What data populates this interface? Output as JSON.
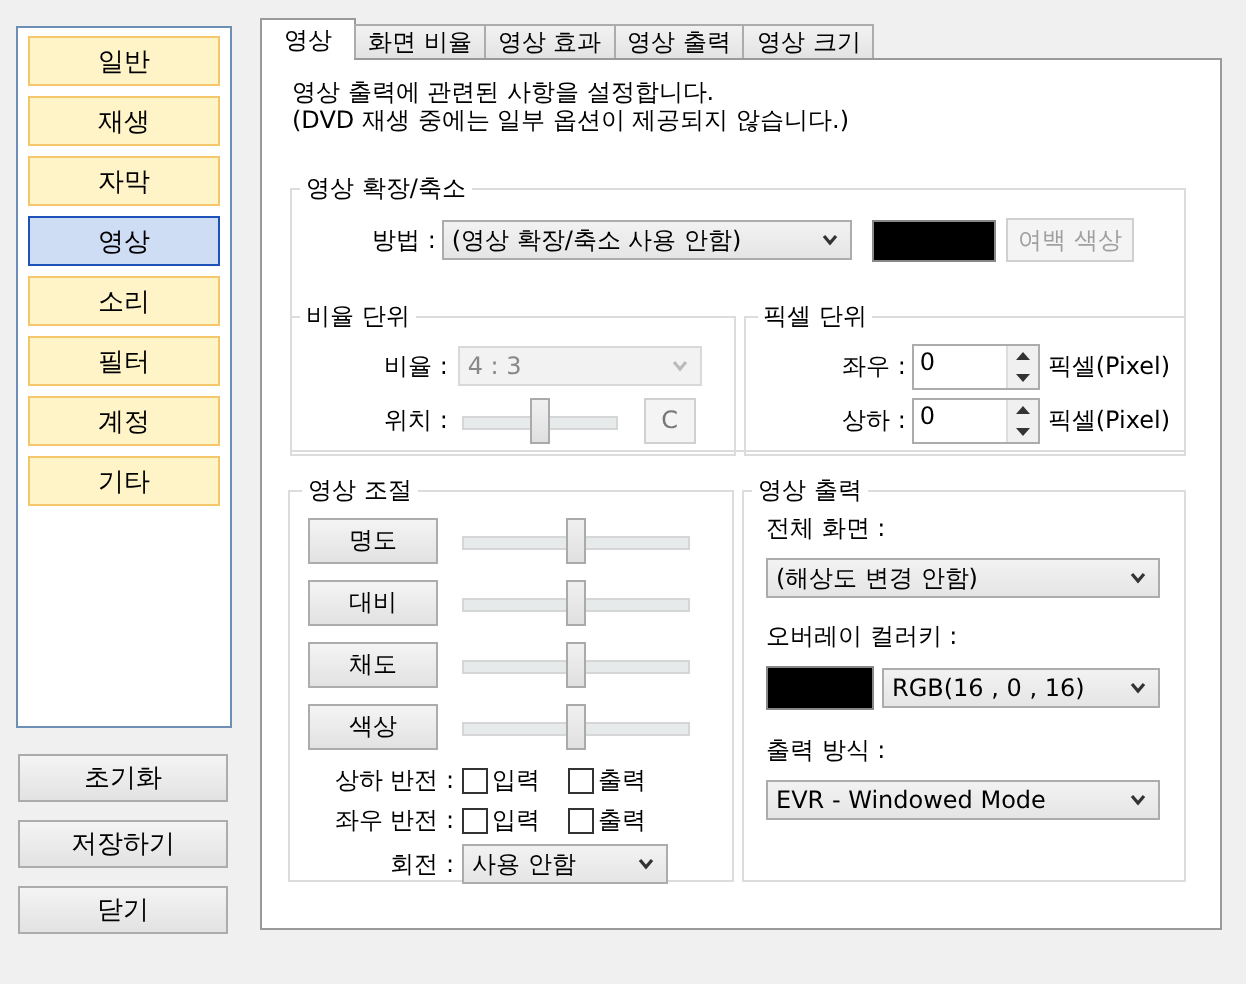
{
  "sidebar": {
    "items": [
      {
        "label": "일반",
        "selected": false
      },
      {
        "label": "재생",
        "selected": false
      },
      {
        "label": "자막",
        "selected": false
      },
      {
        "label": "영상",
        "selected": true
      },
      {
        "label": "소리",
        "selected": false
      },
      {
        "label": "필터",
        "selected": false
      },
      {
        "label": "계정",
        "selected": false
      },
      {
        "label": "기타",
        "selected": false
      }
    ],
    "buttons": [
      "초기화",
      "저장하기",
      "닫기"
    ]
  },
  "tabs": [
    {
      "label": "영상",
      "selected": true
    },
    {
      "label": "화면 비율",
      "selected": false
    },
    {
      "label": "영상 효과",
      "selected": false
    },
    {
      "label": "영상 출력",
      "selected": false
    },
    {
      "label": "영상 크기",
      "selected": false
    }
  ],
  "description": "영상 출력에 관련된 사항을 설정합니다.\n(DVD 재생 중에는 일부 옵션이 제공되지 않습니다.)",
  "scaling": {
    "title": "영상 확장/축소",
    "method_label": "방법 :",
    "method_value": "(영상 확장/축소 사용 안함)",
    "margin_swatch": {
      "color": "#000000"
    },
    "margin_button": {
      "label": "여백 색상",
      "disabled": true
    },
    "ratio_unit": {
      "title": "비율 단위",
      "ratio_label": "비율 :",
      "ratio": {
        "value": "4 : 3",
        "disabled": true
      },
      "position_label": "위치 :",
      "position": {
        "level": 0.5
      },
      "reset_button": {
        "label": "C",
        "disabled": true
      }
    },
    "pixel_unit": {
      "title": "픽셀 단위",
      "fields": [
        {
          "label": "좌우 :",
          "value": "0",
          "unit": "픽셀(Pixel)"
        },
        {
          "label": "상하 :",
          "value": "0",
          "unit": "픽셀(Pixel)"
        }
      ]
    }
  },
  "adjust": {
    "title": "영상 조절",
    "sliders": [
      {
        "label": "명도",
        "level": 0.5
      },
      {
        "label": "대비",
        "level": 0.5
      },
      {
        "label": "채도",
        "level": 0.5
      },
      {
        "label": "색상",
        "level": 0.5
      }
    ],
    "flips": [
      {
        "label": "상하 반전 :",
        "options": [
          {
            "label": "입력",
            "checked": false
          },
          {
            "label": "출력",
            "checked": false
          }
        ]
      },
      {
        "label": "좌우 반전 :",
        "options": [
          {
            "label": "입력",
            "checked": false
          },
          {
            "label": "출력",
            "checked": false
          }
        ]
      }
    ],
    "rotation_label": "회전 :",
    "rotation_value": "사용 안함"
  },
  "output": {
    "title": "영상 출력",
    "fullscreen_label": "전체 화면 :",
    "fullscreen_value": "(해상도 변경 안함)",
    "overlay_label": "오버레이 컬러키 :",
    "overlay_swatch": {
      "color": "#000000"
    },
    "overlay_value": "RGB(16 , 0 , 16)",
    "method_label": "출력 방식 :",
    "method_value": "EVR - Windowed Mode"
  }
}
